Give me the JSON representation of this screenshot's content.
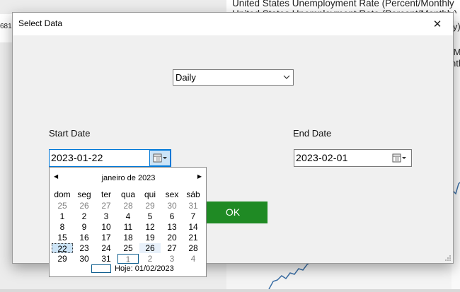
{
  "background": {
    "title_line1": "United States Unemployment Rate  (Percent/Monthly",
    "title_line2": "United States Unemployment Rate (Percent/Monthly)",
    "left_text": "681",
    "right_text_1": "ly)",
    "right_text_2": "/M",
    "right_text_3": "nth"
  },
  "dialog": {
    "title": "Select Data",
    "close_glyph": "✕",
    "frequency_select": {
      "value": "Daily"
    },
    "start_label": "Start Date",
    "end_label": "End Date",
    "start_date": "2023-01-22",
    "end_date": "2023-02-01",
    "ok_label": "OK"
  },
  "calendar": {
    "month_label": "janeiro de 2023",
    "prev_glyph": "◀",
    "next_glyph": "▶",
    "weekdays": [
      "dom",
      "seg",
      "ter",
      "qua",
      "qui",
      "sex",
      "sáb"
    ],
    "weeks": [
      [
        "25",
        "26",
        "27",
        "28",
        "29",
        "30",
        "31"
      ],
      [
        "1",
        "2",
        "3",
        "4",
        "5",
        "6",
        "7"
      ],
      [
        "8",
        "9",
        "10",
        "11",
        "12",
        "13",
        "14"
      ],
      [
        "15",
        "16",
        "17",
        "18",
        "19",
        "20",
        "21"
      ],
      [
        "22",
        "23",
        "24",
        "25",
        "26",
        "27",
        "28"
      ],
      [
        "29",
        "30",
        "31",
        "1",
        "2",
        "3",
        "4"
      ]
    ],
    "muted_week_rows": {
      "0": [
        0,
        1,
        2,
        3,
        4,
        5,
        6
      ],
      "5": [
        3,
        4,
        5,
        6
      ]
    },
    "selected_day": "22",
    "hover_day": "26",
    "today_day": "1",
    "today_text": "Hoje: 01/02/2023"
  },
  "colors": {
    "ok_button": "#1f8a24",
    "selection": "#cce4f7",
    "accent": "#0078d7"
  }
}
